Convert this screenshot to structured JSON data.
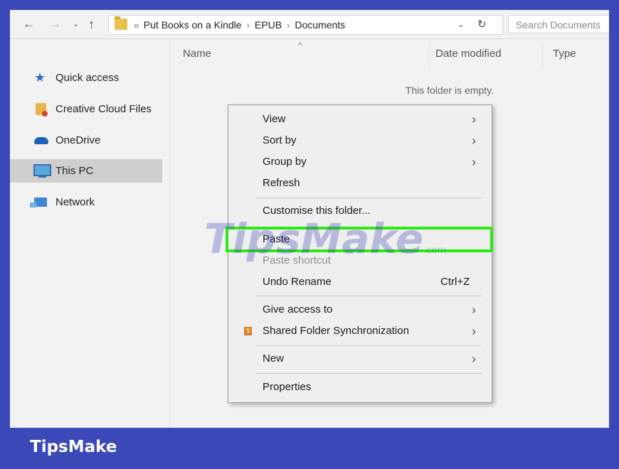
{
  "address": {
    "back_glyph": "←",
    "forward_glyph": "→",
    "history_glyph": "⌄",
    "up_glyph": "↑",
    "lead": "«",
    "crumbs": [
      "Put Books on a Kindle",
      "EPUB",
      "Documents"
    ],
    "separator": "›",
    "dropdown_glyph": "⌄",
    "refresh_glyph": "↻",
    "search_placeholder": "Search Documents"
  },
  "sidebar": {
    "items": [
      {
        "label": "Quick access",
        "icon": "star-icon"
      },
      {
        "label": "Creative Cloud Files",
        "icon": "creative-cloud-folder-icon"
      },
      {
        "label": "OneDrive",
        "icon": "cloud-icon"
      },
      {
        "label": "This PC",
        "icon": "computer-icon"
      },
      {
        "label": "Network",
        "icon": "network-icon"
      }
    ],
    "selected": "This PC",
    "star_glyph": "★"
  },
  "content": {
    "columns": [
      "Name",
      "Date modified",
      "Type"
    ],
    "sort_glyph": "^",
    "empty_message": "This folder is empty."
  },
  "context_menu": {
    "arrow_glyph": "›",
    "items": [
      {
        "label": "View",
        "submenu": true
      },
      {
        "label": "Sort by",
        "submenu": true
      },
      {
        "label": "Group by",
        "submenu": true
      },
      {
        "label": "Refresh"
      },
      {
        "label": "Customise this folder..."
      },
      {
        "label": "Paste",
        "highlighted": true
      },
      {
        "label": "Paste shortcut",
        "disabled": true
      },
      {
        "label": "Undo Rename",
        "shortcut": "Ctrl+Z"
      },
      {
        "label": "Give access to",
        "submenu": true
      },
      {
        "label": "Shared Folder Synchronization",
        "submenu": true,
        "icon": "sync-icon",
        "icon_glyph": "S"
      },
      {
        "label": "New",
        "submenu": true
      },
      {
        "label": "Properties"
      }
    ],
    "highlight_color": "#2fe81a"
  },
  "watermark": {
    "text": "TipsMake",
    "suffix": ".com"
  },
  "footer": {
    "brand": "TipsMake",
    "background": "#3b48b8"
  }
}
